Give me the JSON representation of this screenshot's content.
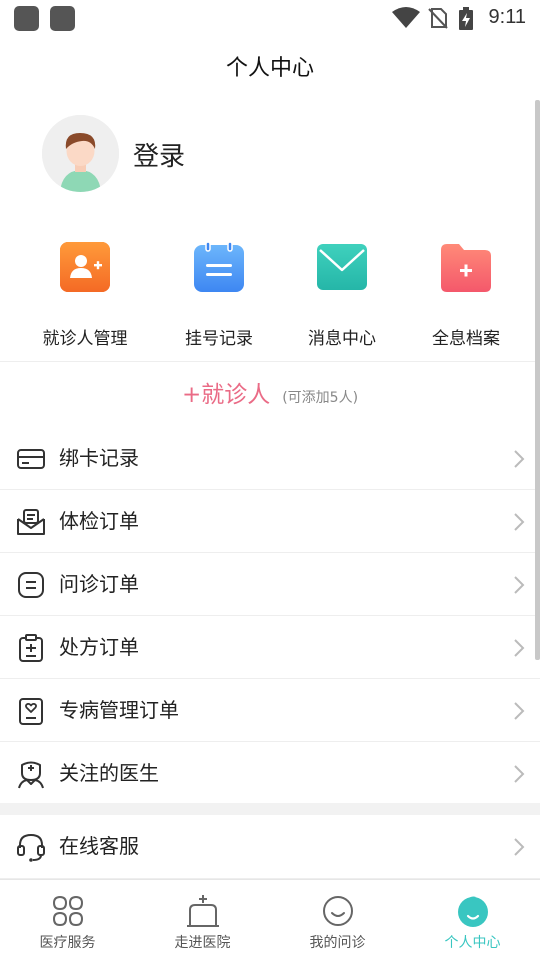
{
  "status_bar": {
    "time": "9:11"
  },
  "header": {
    "title": "个人中心"
  },
  "profile": {
    "login_label": "登录"
  },
  "shortcuts": [
    {
      "label": "就诊人管理",
      "icon": "add-patient-icon",
      "color": "#f4742a"
    },
    {
      "label": "挂号记录",
      "icon": "calendar-icon",
      "color": "#4b97f5"
    },
    {
      "label": "消息中心",
      "icon": "mail-icon",
      "color": "#2fc3b4"
    },
    {
      "label": "全息档案",
      "icon": "folder-plus-icon",
      "color": "#f46670"
    }
  ],
  "add_patient": {
    "label": "+就诊人",
    "hint": "(可添加5人)",
    "color": "#ea6b86"
  },
  "menu": [
    {
      "label": "绑卡记录",
      "icon": "card-icon"
    },
    {
      "label": "体检订单",
      "icon": "checkup-icon"
    },
    {
      "label": "问诊订单",
      "icon": "consult-icon"
    },
    {
      "label": "处方订单",
      "icon": "prescription-icon"
    },
    {
      "label": "专病管理订单",
      "icon": "disease-management-icon"
    },
    {
      "label": "关注的医生",
      "icon": "doctor-icon"
    },
    {
      "label": "在线客服",
      "icon": "headset-icon"
    }
  ],
  "bottom_nav": [
    {
      "label": "医疗服务",
      "icon": "services-icon",
      "active": false
    },
    {
      "label": "走进医院",
      "icon": "hospital-icon",
      "active": false
    },
    {
      "label": "我的问诊",
      "icon": "smile-icon",
      "active": false
    },
    {
      "label": "个人中心",
      "icon": "baby-face-icon",
      "active": true
    }
  ],
  "colors": {
    "accent": "#39c6c1"
  }
}
